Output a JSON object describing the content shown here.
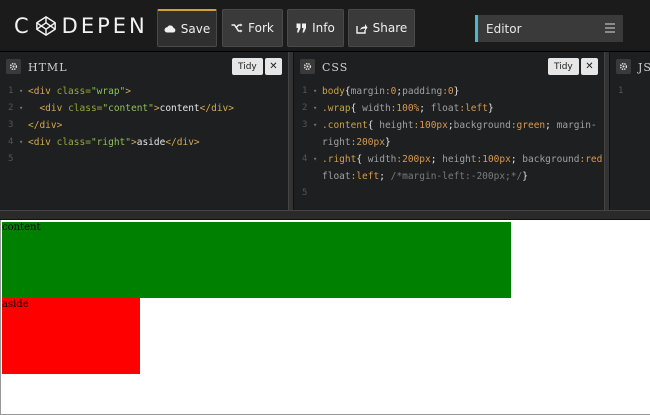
{
  "app": {
    "logo_left": "C",
    "logo_right": "DEPEN"
  },
  "toolbar": {
    "save_label": "Save",
    "fork_label": "Fork",
    "info_label": "Info",
    "share_label": "Share",
    "editor_select": "Editor"
  },
  "panes": {
    "html": {
      "title": "HTML",
      "tidy": "Tidy",
      "close": "✕"
    },
    "css": {
      "title": "CSS",
      "tidy": "Tidy",
      "close": "✕"
    },
    "js": {
      "title": "JS"
    }
  },
  "html_code": {
    "line_numbers": [
      "1",
      "2",
      "3",
      "4",
      "5"
    ],
    "l1_open": "<div ",
    "l1_attr": "class=",
    "l1_val": "\"wrap\"",
    "l1_close": ">",
    "l2_open": "<div ",
    "l2_attr": "class=",
    "l2_val": "\"content\"",
    "l2_close": ">",
    "l2_text": "content",
    "l2_end": "</div>",
    "l3_text": "</div>",
    "l4_open": "<div ",
    "l4_attr": "class=",
    "l4_val": "\"right\"",
    "l4_close": ">",
    "l4_text": "aside",
    "l4_end": "</div>"
  },
  "css_code": {
    "line_numbers": [
      "1",
      "2",
      "3",
      "4",
      "5"
    ],
    "l1_sel": "body",
    "l1_a": "{",
    "l1_p1": "margin",
    "l1_v1": ":0",
    "l1_s1": ";",
    "l1_p2": "padding",
    "l1_v2": ":0",
    "l1_b": "}",
    "l2_sel": ".wrap",
    "l2_a": "{ ",
    "l2_p1": "width",
    "l2_v1": ":100%",
    "l2_s1": "; ",
    "l2_p2": "float",
    "l2_v2": ":left",
    "l2_b": "}",
    "l3_sel": ".content",
    "l3_a": "{ ",
    "l3_p1": "height",
    "l3_v1": ":100px",
    "l3_s1": ";",
    "l3_p2": "background",
    "l3_v2": ":green",
    "l3_s2": "; ",
    "l3_p3": "margin-",
    "l3_p3b": "right",
    "l3_v3": ":200px",
    "l3_b": "}",
    "l4_sel": ".right",
    "l4_a": "{ ",
    "l4_p1": "width",
    "l4_v1": ":200px",
    "l4_s1": "; ",
    "l4_p2": "height",
    "l4_v2": ":100px",
    "l4_s2": "; ",
    "l4_p3": "background",
    "l4_v3": ":red",
    "l4_s3": ";",
    "l4_p4": "float",
    "l4_v4": ":left",
    "l4_s4": "; ",
    "l4_comment": "/*margin-left:-200px;*/",
    "l4_b": "}"
  },
  "js_code": {
    "line_numbers": [
      "1"
    ]
  },
  "preview": {
    "content_text": "content",
    "aside_text": "aside",
    "content_color": "#008000",
    "aside_color": "#ff0000"
  },
  "colors": {
    "topbar": "#1b1b1b",
    "editor_bg": "#1d1f21",
    "active_accent": "#d7a034",
    "select_accent": "#4fb7c8"
  }
}
